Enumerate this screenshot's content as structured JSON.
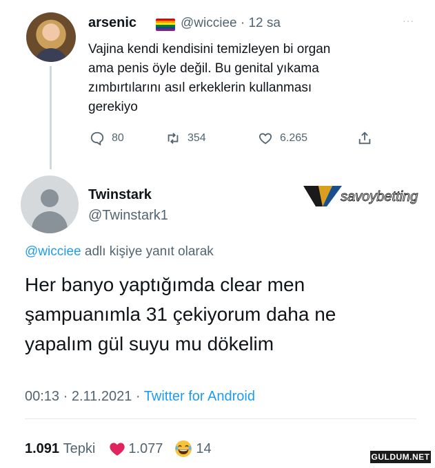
{
  "parent_tweet": {
    "display_name": "arsenic",
    "flag_icon": "rainbow-flag-icon",
    "handle": "@wicciee",
    "separator": "·",
    "time": "12 sa",
    "more": "···",
    "text_lines": [
      "Vajina kendi kendisini temizleyen bi organ",
      "ama penis öyle değil. Bu genital yıkama",
      "zımbırtılarını asıl erkeklerin kullanması",
      "gerekiyo"
    ],
    "actions": {
      "replies": "80",
      "retweets": "354",
      "likes": "6.265"
    }
  },
  "reply_tweet": {
    "display_name": "Twinstark",
    "handle": "@Twinstark1",
    "replying_to_mention": "@wicciee",
    "replying_to_suffix": " adlı kişiye yanıt olarak",
    "text_lines": [
      "Her banyo yaptığımda clear men",
      "şampuanımla 31 çekiyorum daha ne",
      "yapalım gül suyu mu dökelim"
    ],
    "time": "00:13",
    "date": "2.11.2021",
    "separator": " · ",
    "source": "Twitter for Android",
    "total_reactions": "1.091",
    "reactions_label": "Tepki",
    "heart_count": "1.077",
    "laugh_count": "14"
  },
  "watermark_logo": {
    "text": "savoybetting"
  },
  "watermark_site": {
    "text": "GULDUM.NET"
  },
  "colors": {
    "link": "#1d9bf0",
    "muted": "#536471",
    "heart": "#e0245e"
  }
}
